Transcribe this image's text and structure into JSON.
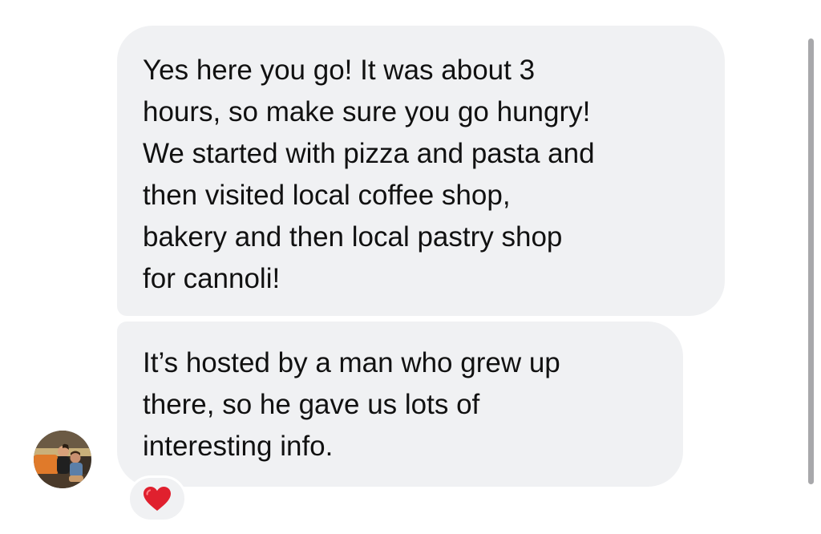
{
  "messages": [
    {
      "lines": [
        "Yes here you go! It was about 3",
        "hours, so make sure you go hungry!",
        "We started with pizza and pasta and",
        "then visited local coffee shop,",
        "bakery and then local pastry shop",
        "for cannoli!"
      ]
    },
    {
      "lines": [
        "It’s hosted by a man who grew up",
        "there, so he gave us lots of",
        "interesting info."
      ]
    }
  ],
  "sender": {
    "avatar_icon": "profile-photo-avatar"
  },
  "reaction": {
    "icon": "red-heart-icon",
    "color": "#e0202e"
  },
  "colors": {
    "bubble_bg": "#f0f1f3",
    "text": "#111111",
    "scrollbar": "#a8a8ab"
  }
}
